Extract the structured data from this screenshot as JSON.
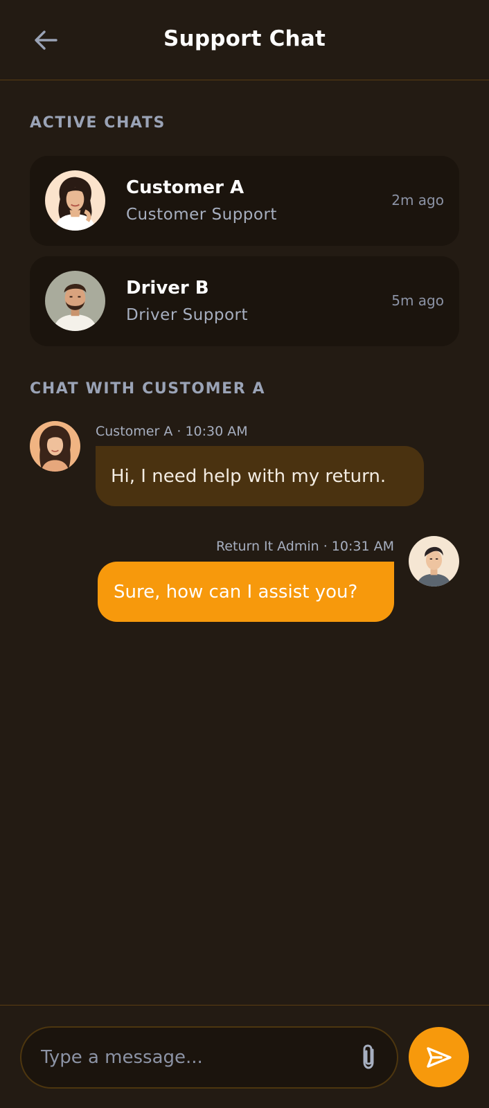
{
  "header": {
    "title": "Support Chat",
    "back_icon": "arrow-left-icon"
  },
  "active_chats": {
    "label": "ACTIVE CHATS",
    "items": [
      {
        "name": "Customer A",
        "subtitle": "Customer Support",
        "time": "2m ago",
        "avatar": "woman-avatar"
      },
      {
        "name": "Driver B",
        "subtitle": "Driver Support",
        "time": "5m ago",
        "avatar": "bearded-man-avatar"
      }
    ]
  },
  "conversation": {
    "label": "CHAT WITH CUSTOMER A",
    "messages": [
      {
        "sender": "Customer A",
        "time": "10:30 AM",
        "meta": "Customer A · 10:30 AM",
        "text": "Hi, I need help with my return.",
        "direction": "incoming"
      },
      {
        "sender": "Return It Admin",
        "time": "10:31 AM",
        "meta": "Return It Admin · 10:31 AM",
        "text": "Sure, how can I assist you?",
        "direction": "outgoing"
      }
    ]
  },
  "composer": {
    "placeholder": "Type a message...",
    "value": "",
    "attach_icon": "paperclip-icon",
    "send_icon": "send-icon"
  },
  "colors": {
    "background": "#231b13",
    "accent": "#f7990c",
    "incoming_bubble": "#4a3210",
    "card": "#1b140d",
    "muted_text": "#a7afc0"
  }
}
